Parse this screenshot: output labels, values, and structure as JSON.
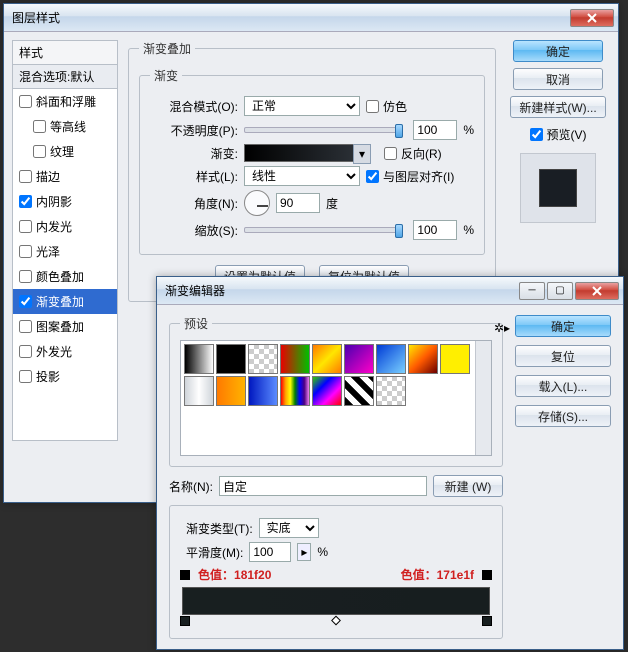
{
  "layerStyle": {
    "title": "图层样式",
    "stylesHeader": "样式",
    "blendDefault": "混合选项:默认",
    "items": [
      {
        "label": "斜面和浮雕",
        "checked": false,
        "indent": false
      },
      {
        "label": "等高线",
        "checked": false,
        "indent": true
      },
      {
        "label": "纹理",
        "checked": false,
        "indent": true
      },
      {
        "label": "描边",
        "checked": false,
        "indent": false
      },
      {
        "label": "内阴影",
        "checked": true,
        "indent": false
      },
      {
        "label": "内发光",
        "checked": false,
        "indent": false
      },
      {
        "label": "光泽",
        "checked": false,
        "indent": false
      },
      {
        "label": "颜色叠加",
        "checked": false,
        "indent": false
      },
      {
        "label": "渐变叠加",
        "checked": true,
        "indent": false,
        "active": true
      },
      {
        "label": "图案叠加",
        "checked": false,
        "indent": false
      },
      {
        "label": "外发光",
        "checked": false,
        "indent": false
      },
      {
        "label": "投影",
        "checked": false,
        "indent": false
      }
    ],
    "group": {
      "legend": "渐变叠加",
      "subLegend": "渐变",
      "blendLabel": "混合模式(O):",
      "blendValue": "正常",
      "dither": "仿色",
      "opacityLabel": "不透明度(P):",
      "opacityValue": "100",
      "pct": "%",
      "gradientLabel": "渐变:",
      "reverse": "反向(R)",
      "styleLabel": "样式(L):",
      "styleValue": "线性",
      "align": "与图层对齐(I)",
      "angleLabel": "角度(N):",
      "angleValue": "90",
      "deg": "度",
      "scaleLabel": "缩放(S):",
      "scaleValue": "100",
      "setDefault": "设置为默认值",
      "resetDefault": "复位为默认值"
    },
    "right": {
      "ok": "确定",
      "cancel": "取消",
      "newStyle": "新建样式(W)...",
      "preview": "预览(V)"
    }
  },
  "gradEditor": {
    "title": "渐变编辑器",
    "presetsLegend": "预设",
    "ok": "确定",
    "reset": "复位",
    "load": "载入(L)...",
    "save": "存储(S)...",
    "nameLabel": "名称(N):",
    "nameValue": "自定",
    "newBtn": "新建 (W)",
    "typeLabel": "渐变类型(T):",
    "typeValue": "实底",
    "smoothLabel": "平滑度(M):",
    "smoothValue": "100",
    "pct": "%",
    "c1label": "色值：",
    "c1": "181f20",
    "c2label": "色值：",
    "c2": "171e1f",
    "presets": [
      "linear-gradient(90deg,#000,#fff)",
      "linear-gradient(90deg,#000,#000)",
      "repeating-conic-gradient(#ccc 0 25%,#fff 0 50%) 0/10px 10px",
      "linear-gradient(90deg,#e80000,#00c000)",
      "linear-gradient(135deg,#ff7a00,#ffe600,#ff7a00)",
      "linear-gradient(135deg,#4a00b0,#ff00c8)",
      "linear-gradient(135deg,#003bd6,#7ad0ff)",
      "linear-gradient(135deg,#ffe600,#ff5a00,#6b0000)",
      "linear-gradient(90deg,#ffef00,#ffef00)",
      "linear-gradient(90deg,#cfd4da,#fff,#cfd4da)",
      "linear-gradient(90deg,#ff7a00,#ffb300)",
      "linear-gradient(90deg,#0018c0,#5a8bff)",
      "linear-gradient(90deg,red,orange,yellow,green,blue,indigo,violet)",
      "linear-gradient(135deg,#3c0,#00f,#f0f,#f00)",
      "repeating-linear-gradient(45deg,#000 0 6px,#fff 6px 12px)",
      "repeating-conic-gradient(#ccc 0 25%,#fff 0 50%) 0/10px 10px"
    ]
  }
}
